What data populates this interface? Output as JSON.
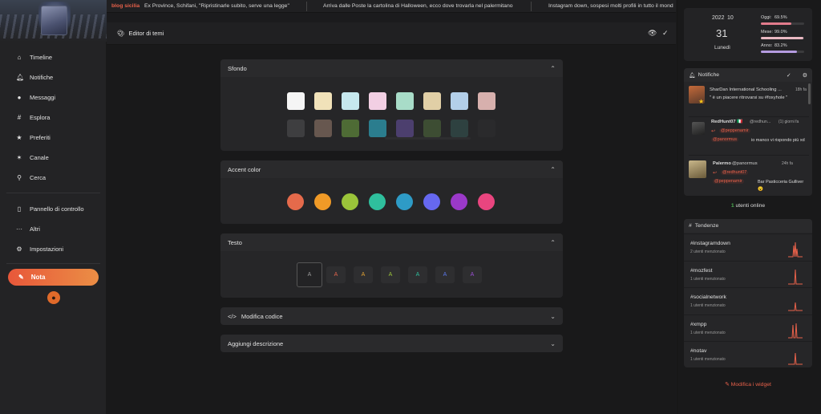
{
  "ticker": {
    "source": "blog sicilia",
    "items": [
      "Ex Province, Schifani, \"Ripristinarle subito, serve una legge\"",
      "Arriva dalle Poste la cartolina di Halloween, ecco dove trovarla nel palermitano",
      "Instagram down, sospesi molti profili in tutto il mond"
    ]
  },
  "sidebar": {
    "items": [
      {
        "label": "Timeline",
        "icon": "home-icon"
      },
      {
        "label": "Notifiche",
        "icon": "bell-icon"
      },
      {
        "label": "Messaggi",
        "icon": "comments-icon"
      },
      {
        "label": "Esplora",
        "icon": "hashtag-icon"
      },
      {
        "label": "Preferiti",
        "icon": "star-icon"
      },
      {
        "label": "Canale",
        "icon": "satellite-icon"
      },
      {
        "label": "Cerca",
        "icon": "search-icon"
      }
    ],
    "items2": [
      {
        "label": "Pannello di controllo",
        "icon": "door-icon"
      },
      {
        "label": "Altri",
        "icon": "ellipsis-icon"
      },
      {
        "label": "Impostazioni",
        "icon": "gear-icon"
      }
    ],
    "note_button": "Nota"
  },
  "editor": {
    "title": "Editor di temi",
    "sections": {
      "background": "Sfondo",
      "accent": "Accent color",
      "text": "Testo",
      "code": "Modifica codice",
      "description": "Aggiungi descrizione"
    },
    "bg_light": [
      "#f5f5f5",
      "#f1e2b9",
      "#c6e8ee",
      "#f2cfe3",
      "#a8dcc8",
      "#e1cfa6",
      "#b3cfe9",
      "#d7b0ad"
    ],
    "bg_dark": [
      "#3e3e40",
      "#67574f",
      "#4e6b35",
      "#2b7d8e",
      "#4c3f6e",
      "#3d4d33",
      "#2e4140",
      "#2a2a2c"
    ],
    "accents": [
      "#e56a4b",
      "#f09a27",
      "#9bc43a",
      "#2fbf9d",
      "#2e9bc6",
      "#6668f0",
      "#9b39c9",
      "#e9457f"
    ],
    "text_sample": "A",
    "text_colors": [
      "#9a9a9a",
      "#e0644d",
      "#e3a233",
      "#9bc43a",
      "#2fbf9d",
      "#5b78ea",
      "#9b4fd4"
    ]
  },
  "stats": {
    "year": "2022",
    "month": "10",
    "day": "31",
    "weekday": "Lunedì",
    "today_label": "Oggi:",
    "today_value": "69.5%",
    "today_fraction": 0.695,
    "month_label": "Mese:",
    "month_value": "99.0%",
    "month_fraction": 0.99,
    "year_label": "Anno:",
    "year_value": "83.2%",
    "year_fraction": 0.832
  },
  "notifications": {
    "title": "Notifiche",
    "items": [
      {
        "user": "SharDan  International Schooling ...",
        "time": "18h fa",
        "text": "\" è un piacere ritrovarsi su #foxyhole \""
      },
      {
        "user": "RedHunt07 🇮🇹",
        "handle": "@redhun...",
        "time": "(1) giorni fa",
        "mention": "@peppenamir",
        "mention2": "@panormus",
        "text": "io manco vi rispondo più xd"
      },
      {
        "user": "Palermo",
        "handle": "@panormus",
        "time": "24h fa",
        "mention": "@redhunt07",
        "mention2": "@peppenamir",
        "text": "Bar Pasticceria Gulliver 😮"
      }
    ]
  },
  "online": {
    "count": "1",
    "label": "utenti online"
  },
  "trends": {
    "title": "Tendenze",
    "items": [
      {
        "tag": "#instagramdown",
        "count": "2 utenti menzionato"
      },
      {
        "tag": "#mozfest",
        "count": "1 utenti menzionato"
      },
      {
        "tag": "#socialnetwork",
        "count": "1 utenti menzionato"
      },
      {
        "tag": "#xmpp",
        "count": "1 utenti menzionato"
      },
      {
        "tag": "#notav",
        "count": "1 utenti menzionato"
      }
    ]
  },
  "widgets_link": "Modifica i widget",
  "colors": {
    "accent": "#e8573a",
    "accent2": "#eb8e45",
    "online": "#4caf50"
  }
}
